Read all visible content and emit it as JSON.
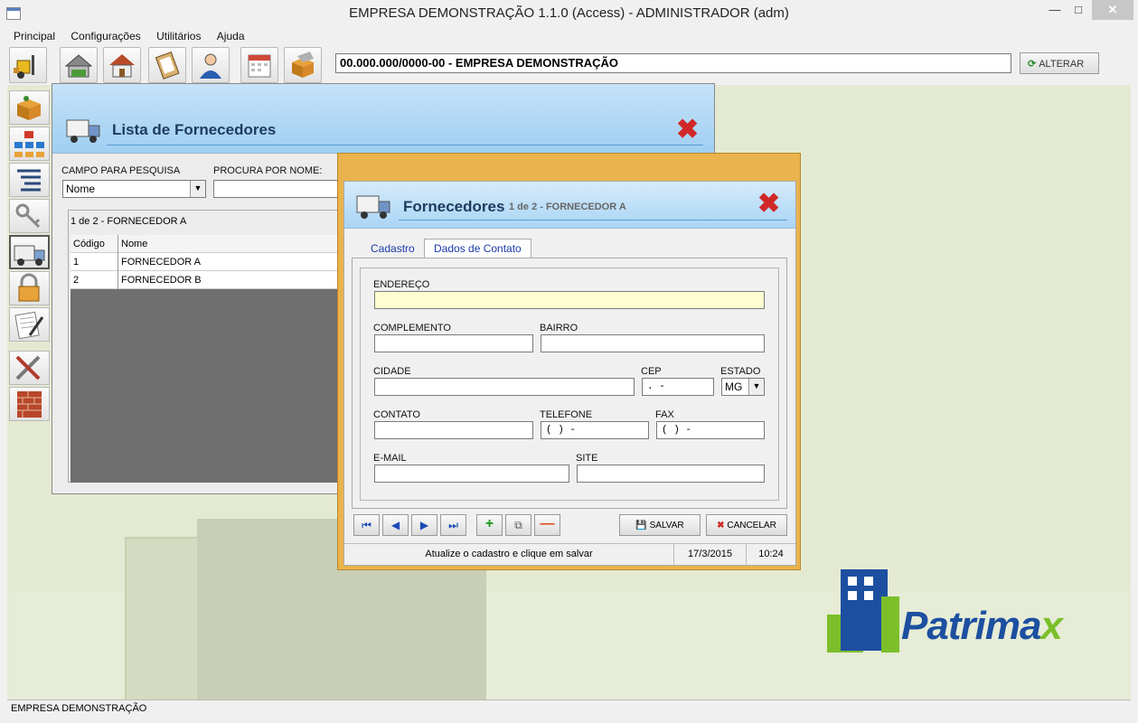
{
  "window": {
    "title": "EMPRESA DEMONSTRAÇÃO 1.1.0 (Access) - ADMINISTRADOR (adm)"
  },
  "menu": [
    "Principal",
    "Configurações",
    "Utilitários",
    "Ajuda"
  ],
  "toolbar": {
    "company": "00.000.000/0000-00 - EMPRESA DEMONSTRAÇÃO",
    "alterar_label": "ALTERAR"
  },
  "status": {
    "text": "EMPRESA DEMONSTRAÇÃO"
  },
  "lista": {
    "title": "Lista de Fornecedores",
    "campo_label": "CAMPO PARA PESQUISA",
    "campo_value": "Nome",
    "procura_label": "PROCURA POR NOME:",
    "count": "1 de 2 - FORNECEDOR A",
    "columns": [
      "Código",
      "Nome"
    ],
    "rows": [
      [
        "1",
        "FORNECEDOR A"
      ],
      [
        "2",
        "FORNECEDOR B"
      ]
    ]
  },
  "fornecedores": {
    "title": "Fornecedores",
    "subtitle": "1 de 2 - FORNECEDOR A",
    "tabs": [
      "Cadastro",
      "Dados de Contato"
    ],
    "fields": {
      "endereco": "ENDEREÇO",
      "complemento": "COMPLEMENTO",
      "bairro": "BAIRRO",
      "cidade": "CIDADE",
      "cep": "CEP",
      "estado": "ESTADO",
      "contato": "CONTATO",
      "telefone": "TELEFONE",
      "fax": "FAX",
      "email": "E-MAIL",
      "site": "SITE"
    },
    "values": {
      "cep_mask": ".  -",
      "estado": "MG",
      "telefone_mask": "( )   -",
      "fax_mask": "( )   -"
    },
    "buttons": {
      "salvar": "SALVAR",
      "cancelar": "CANCELAR"
    },
    "status": {
      "message": "Atualize o cadastro e clique em salvar",
      "date": "17/3/2015",
      "time": "10:24"
    }
  },
  "logo": {
    "text_main": "Patrima",
    "text_accent": "x"
  }
}
